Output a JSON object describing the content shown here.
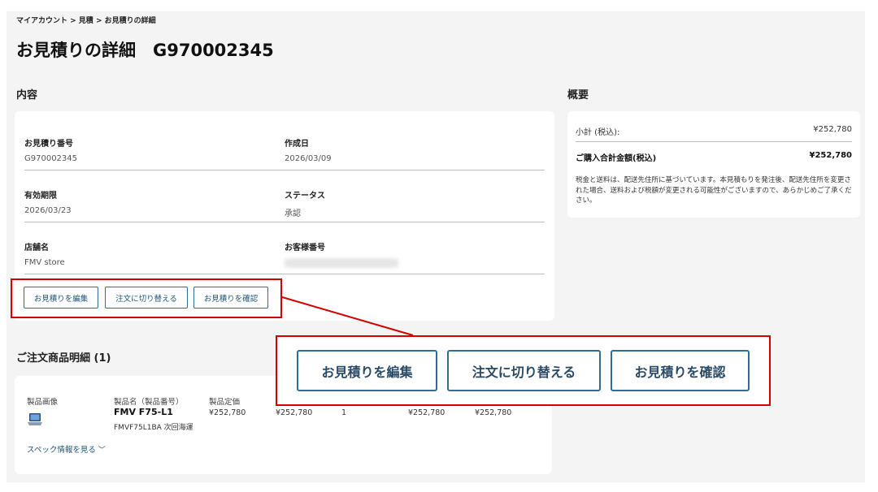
{
  "breadcrumb": "マイアカウント > 見積 > お見積りの詳細",
  "page_title": "お見積りの詳細　G970002345",
  "details": {
    "heading": "内容",
    "fields": [
      {
        "label": "お見積り番号",
        "value": "G970002345"
      },
      {
        "label": "作成日",
        "value": "2026/03/09"
      },
      {
        "label": "有効期限",
        "value": "2026/03/23"
      },
      {
        "label": "ステータス",
        "value": "承認"
      },
      {
        "label": "店舗名",
        "value": "FMV store"
      },
      {
        "label": "お客様番号",
        "value": ""
      }
    ],
    "buttons": {
      "edit": "お見積りを編集",
      "convert": "注文に切り替える",
      "confirm": "お見積りを確認"
    }
  },
  "summary": {
    "heading": "概要",
    "subtotal_label": "小計 (税込):",
    "subtotal_value": "¥252,780",
    "total_label": "ご購入合計金額(税込)",
    "total_value": "¥252,780",
    "note": "税金と送料は、配送先住所に基づいています。本見積もりを発注後、配送先住所を変更された場合、送料および税額が変更される可能性がございますので、あらかじめご了承ください。"
  },
  "items": {
    "heading": "ご注文商品明細 (1)",
    "columns": {
      "image": "製品画像",
      "name": "製品名（製品番号）",
      "price": "製品定価"
    },
    "rows": [
      {
        "name": "FMV F75-L1",
        "code": "FMVF75L1BA 次回海運",
        "list_price": "¥252,780",
        "sale_price": "¥252,780",
        "quantity": "1",
        "subtotal": "¥252,780",
        "total": "¥252,780"
      }
    ],
    "spec_link": "スペック情報を見る"
  },
  "colors": {
    "accent": "#2f6d92",
    "highlight": "#d40000",
    "background": "#f4f4f4",
    "card": "#ffffff"
  },
  "icons": {
    "product_thumbnail": "laptop-icon",
    "spec_chevron": "chevron-down-icon"
  }
}
